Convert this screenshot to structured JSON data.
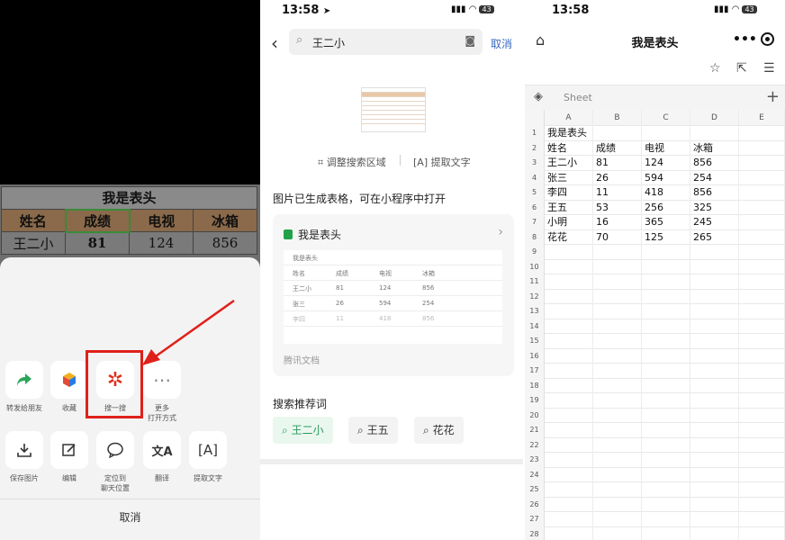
{
  "panel1": {
    "table": {
      "title": "我是表头",
      "headers": [
        "姓名",
        "成绩",
        "电视",
        "冰箱"
      ],
      "row": [
        "王二小",
        "81",
        "124",
        "856"
      ]
    },
    "actions_row1": [
      {
        "label": "转发给朋友",
        "icon": "share-arrow-icon"
      },
      {
        "label": "收藏",
        "icon": "cube-icon"
      },
      {
        "label": "搜一搜",
        "icon": "sparkle-icon"
      },
      {
        "label": "更多\n打开方式",
        "icon": "more-dots-icon"
      }
    ],
    "actions_row2": [
      {
        "label": "保存图片",
        "icon": "download-icon"
      },
      {
        "label": "编辑",
        "icon": "edit-icon"
      },
      {
        "label": "定位到\n聊天位置",
        "icon": "chat-bubble-icon"
      },
      {
        "label": "翻译",
        "icon": "translate-icon"
      },
      {
        "label": "提取文字",
        "icon": "extract-text-icon"
      }
    ],
    "cancel": "取消",
    "highlight_color": "#e0201a"
  },
  "panel2": {
    "time": "13:58",
    "battery": "43",
    "search_value": "王二小",
    "cancel": "取消",
    "adjust": "调整搜索区域",
    "extract": "提取文字",
    "generated": "图片已生成表格，可在小程序中打开",
    "card": {
      "title": "我是表头",
      "mini_title": "我是表头",
      "mini_rows": [
        [
          "姓名",
          "成绩",
          "电视",
          "冰箱"
        ],
        [
          "王二小",
          "81",
          "124",
          "856"
        ],
        [
          "张三",
          "26",
          "594",
          "254"
        ],
        [
          "李四",
          "11",
          "418",
          "856"
        ]
      ],
      "source": "腾讯文档"
    },
    "recommend": "搜索推荐词",
    "chips": [
      "王二小",
      "王五",
      "花花"
    ],
    "accent": "#2a9a5a"
  },
  "panel3": {
    "time": "13:58",
    "battery": "43",
    "title": "我是表头",
    "sheet_name": "Sheet",
    "columns": [
      "A",
      "B",
      "C",
      "D",
      "E"
    ],
    "rows": [
      [
        "我是表头",
        "",
        "",
        ""
      ],
      [
        "姓名",
        "成绩",
        "电视",
        "冰箱"
      ],
      [
        "王二小",
        "81",
        "124",
        "856"
      ],
      [
        "张三",
        "26",
        "594",
        "254"
      ],
      [
        "李四",
        "11",
        "418",
        "856"
      ],
      [
        "王五",
        "53",
        "256",
        "325"
      ],
      [
        "小明",
        "16",
        "365",
        "245"
      ],
      [
        "花花",
        "70",
        "125",
        "265"
      ]
    ],
    "row_count": 28
  }
}
